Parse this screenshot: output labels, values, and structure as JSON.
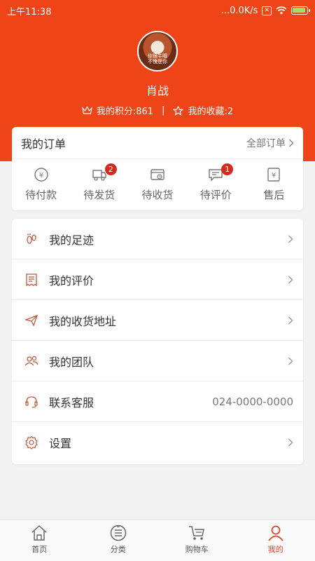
{
  "status_bar": {
    "time": "上午11:38",
    "speed": "...0.0K/s",
    "sim": "✕"
  },
  "colors": {
    "accent": "#ef4418",
    "badge": "#d62a1e",
    "icon": "#c0563a"
  },
  "profile": {
    "username": "肖战",
    "avatar_caption": "你很牛哦\n不愧是你",
    "points_label": "我的积分:861",
    "favorites_label": "我的收藏:2",
    "separator": "|"
  },
  "orders": {
    "title": "我的订单",
    "all_label": "全部订单",
    "items": [
      {
        "label": "待付款",
        "icon": "wallet-icon",
        "badge": ""
      },
      {
        "label": "待发货",
        "icon": "truck-icon",
        "badge": "2"
      },
      {
        "label": "待收货",
        "icon": "delivery-box-icon",
        "badge": ""
      },
      {
        "label": "待评价",
        "icon": "comment-icon",
        "badge": "1"
      },
      {
        "label": "售后",
        "icon": "after-sale-icon",
        "badge": ""
      }
    ]
  },
  "menu": {
    "items": [
      {
        "label": "我的足迹",
        "icon": "footprint-icon"
      },
      {
        "label": "我的评价",
        "icon": "receipt-icon"
      },
      {
        "label": "我的收货地址",
        "icon": "paper-plane-icon"
      },
      {
        "label": "我的团队",
        "icon": "team-icon"
      },
      {
        "label": "联系客服",
        "icon": "headset-icon",
        "value": "024-0000-0000"
      },
      {
        "label": "设置",
        "icon": "settings-gear-icon"
      }
    ]
  },
  "tabbar": {
    "items": [
      {
        "label": "首页",
        "icon": "home-icon"
      },
      {
        "label": "分类",
        "icon": "category-icon"
      },
      {
        "label": "购物车",
        "icon": "cart-icon"
      },
      {
        "label": "我的",
        "icon": "user-icon",
        "active": true
      }
    ]
  }
}
